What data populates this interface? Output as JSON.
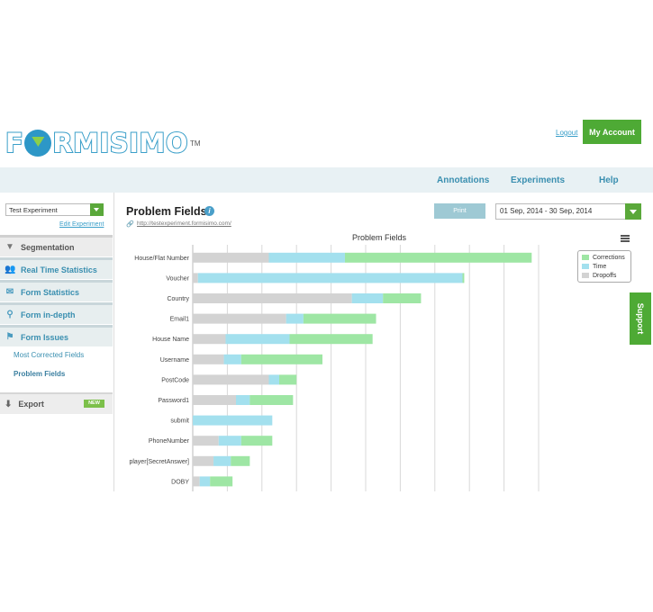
{
  "header": {
    "logo": "FORMISIMO",
    "logo_mark": "TM",
    "logout": "Logout",
    "my_account": "My Account"
  },
  "nav": {
    "annotations": "Annotations",
    "experiments": "Experiments",
    "help": "Help"
  },
  "sidebar": {
    "experiment_select": "Test Experiment",
    "edit_experiment": "Edit Experiment",
    "items": [
      {
        "label": "Segmentation",
        "icon": "funnel-icon"
      },
      {
        "label": "Real Time Statistics",
        "icon": "users-icon"
      },
      {
        "label": "Form Statistics",
        "icon": "envelope-icon"
      },
      {
        "label": "Form in-depth",
        "icon": "magnify-icon"
      },
      {
        "label": "Form Issues",
        "icon": "flag-icon"
      }
    ],
    "sub_items": [
      "Most Corrected Fields",
      "Problem Fields"
    ],
    "export": {
      "label": "Export",
      "badge": "NEW",
      "icon": "download-icon"
    }
  },
  "main": {
    "title": "Problem Fields",
    "url": "http://testexperiment.formisimo.com/",
    "print": "Print",
    "date_range": "01 Sep, 2014 - 30 Sep, 2014"
  },
  "support": "Support",
  "colors": {
    "corrections": "#9ee6a4",
    "time": "#a3e0ee",
    "dropoffs": "#d3d3d3",
    "accent": "#4eaa35",
    "link": "#3a9fc9"
  },
  "chart_data": {
    "type": "bar",
    "orientation": "horizontal",
    "stacked": true,
    "title": "Problem Fields",
    "categories": [
      "House/Flat Number",
      "Voucher",
      "Country",
      "Email1",
      "House Name",
      "Username",
      "PostCode",
      "Password1",
      "submit",
      "PhoneNumber",
      "player[SecretAnswer]",
      "DOBY"
    ],
    "series": [
      {
        "name": "Dropoffs",
        "color": "#d3d3d3",
        "values": [
          22,
          1.5,
          46,
          27,
          9.5,
          9,
          22,
          12.5,
          0,
          7.5,
          6,
          2
        ]
      },
      {
        "name": "Time",
        "color": "#a3e0ee",
        "values": [
          22,
          76.5,
          9,
          5,
          18.5,
          5,
          3,
          4,
          23,
          6.5,
          5,
          3
        ]
      },
      {
        "name": "Corrections",
        "color": "#9ee6a4",
        "values": [
          54,
          0.5,
          11,
          21,
          24,
          23.5,
          5,
          12.5,
          0,
          9,
          5.5,
          6.5
        ]
      }
    ],
    "xlim": [
      0,
      100
    ],
    "grid": true,
    "legend_order": [
      "Corrections",
      "Time",
      "Dropoffs"
    ],
    "legend_position": "top-right"
  }
}
